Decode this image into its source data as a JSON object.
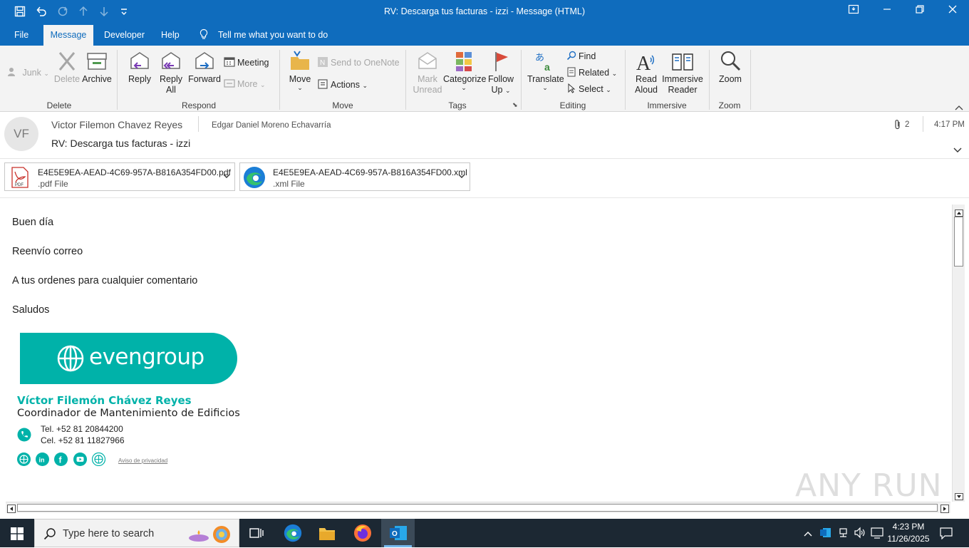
{
  "window": {
    "title": "RV: Descarga tus facturas - izzi  -  Message (HTML)"
  },
  "menu": {
    "file": "File",
    "message": "Message",
    "developer": "Developer",
    "help": "Help",
    "tell_me": "Tell me what you want to do"
  },
  "ribbon": {
    "junk": "Junk",
    "delete": "Delete",
    "archive": "Archive",
    "group_delete": "Delete",
    "reply": "Reply",
    "reply_all_1": "Reply",
    "reply_all_2": "All",
    "forward": "Forward",
    "meeting": "Meeting",
    "more": "More",
    "group_respond": "Respond",
    "move": "Move",
    "send_onenote": "Send to OneNote",
    "actions": "Actions",
    "group_move": "Move",
    "mark_unread_1": "Mark",
    "mark_unread_2": "Unread",
    "categorize": "Categorize",
    "follow_up_1": "Follow",
    "follow_up_2": "Up",
    "group_tags": "Tags",
    "translate": "Translate",
    "find": "Find",
    "related": "Related",
    "select": "Select",
    "group_editing": "Editing",
    "read_aloud_1": "Read",
    "read_aloud_2": "Aloud",
    "immersive_1": "Immersive",
    "immersive_2": "Reader",
    "group_immersive": "Immersive",
    "zoom": "Zoom",
    "group_zoom": "Zoom"
  },
  "message": {
    "avatar_initials": "VF",
    "sender": "Victor Filemon Chavez Reyes",
    "recipient": "Edgar Daniel Moreno Echavarría",
    "subject": "RV: Descarga tus facturas - izzi",
    "attachment_count": "2",
    "time": "4:17 PM"
  },
  "attachments": [
    {
      "name": "E4E5E9EA-AEAD-4C69-957A-B816A354FD00.pdf",
      "type": ".pdf File",
      "icon": "pdf-icon"
    },
    {
      "name": "E4E5E9EA-AEAD-4C69-957A-B816A354FD00.xml",
      "type": ".xml File",
      "icon": "edge-icon"
    }
  ],
  "body": {
    "line1": "Buen día",
    "line2": "Reenvío correo",
    "line3": "A tus ordenes para cualquier comentario",
    "line4": "Saludos"
  },
  "signature": {
    "logo_text": "evengroup",
    "name": "Víctor Filemón Chávez Reyes",
    "role": "Coordinador de Mantenimiento de Edificios",
    "tel": "Tel. +52 81 20844200",
    "cel": "Cel. +52 81 11827966",
    "privacy": "Aviso de privacidad",
    "brand_color": "#00b2a9",
    "icons": [
      "globe-icon",
      "linkedin-icon",
      "facebook-icon",
      "youtube-icon",
      "web-icon"
    ]
  },
  "watermark": "ANY RUN",
  "taskbar": {
    "search_placeholder": "Type here to search",
    "time": "4:23 PM",
    "date": "11/26/2025"
  },
  "colors": {
    "title_blue": "#0f6cbd",
    "taskbar_bg": "#1c2833"
  }
}
